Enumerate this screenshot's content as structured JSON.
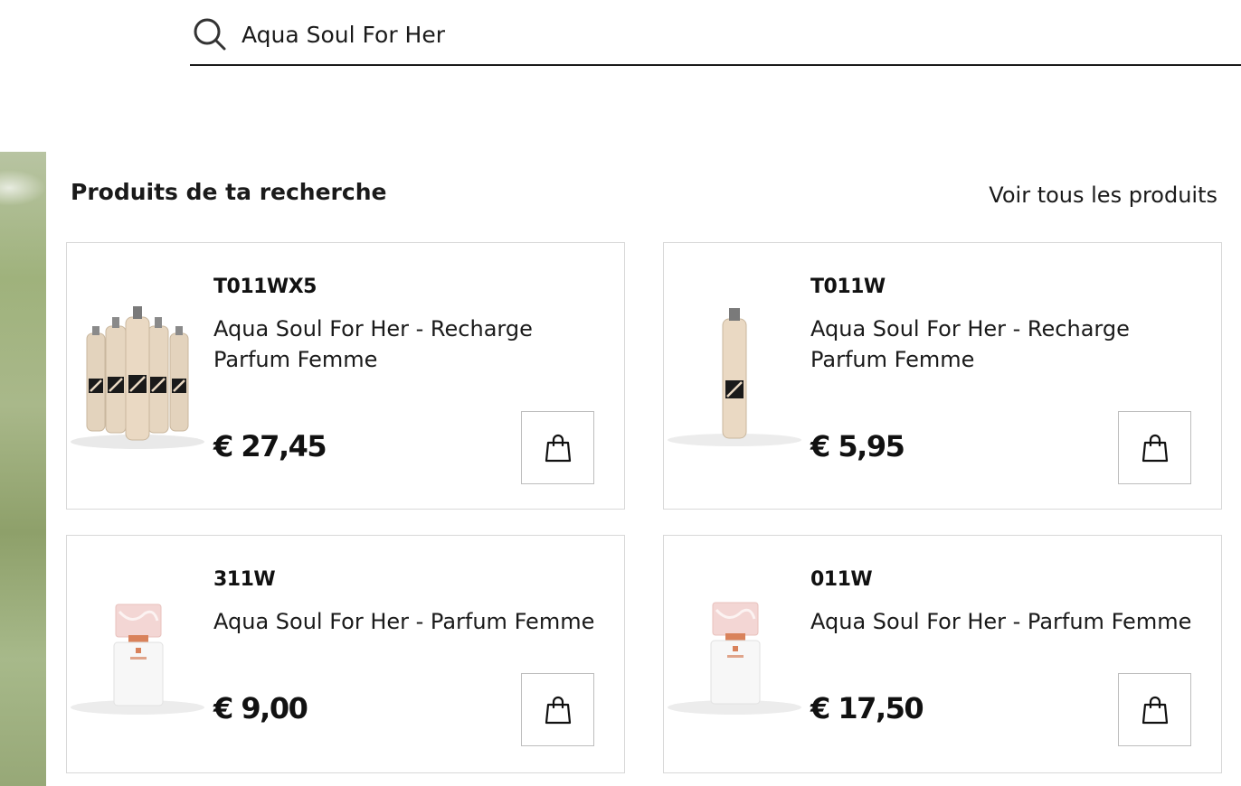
{
  "search": {
    "value": "Aqua Soul For Her",
    "icon": "search-icon"
  },
  "results": {
    "title": "Produits de ta recherche",
    "view_all": "Voir tous les produits"
  },
  "products": [
    {
      "sku": "T011WX5",
      "name": "Aqua Soul For Her - Recharge Parfum Femme",
      "price": "€ 27,45",
      "image": "refill-bottles-5-pack",
      "cart_icon": "shopping-bag-icon"
    },
    {
      "sku": "T011W",
      "name": "Aqua Soul For Her - Recharge Parfum Femme",
      "price": "€ 5,95",
      "image": "refill-bottle-single",
      "cart_icon": "shopping-bag-icon"
    },
    {
      "sku": "311W",
      "name": "Aqua Soul For Her - Parfum Femme",
      "price": "€ 9,00",
      "image": "perfume-bottle-white",
      "cart_icon": "shopping-bag-icon"
    },
    {
      "sku": "011W",
      "name": "Aqua Soul For Her - Parfum Femme",
      "price": "€ 17,50",
      "image": "perfume-bottle-white",
      "cart_icon": "shopping-bag-icon"
    }
  ],
  "colors": {
    "text": "#111111",
    "border": "#d8d8d8",
    "accent_copper": "#d9825b"
  }
}
